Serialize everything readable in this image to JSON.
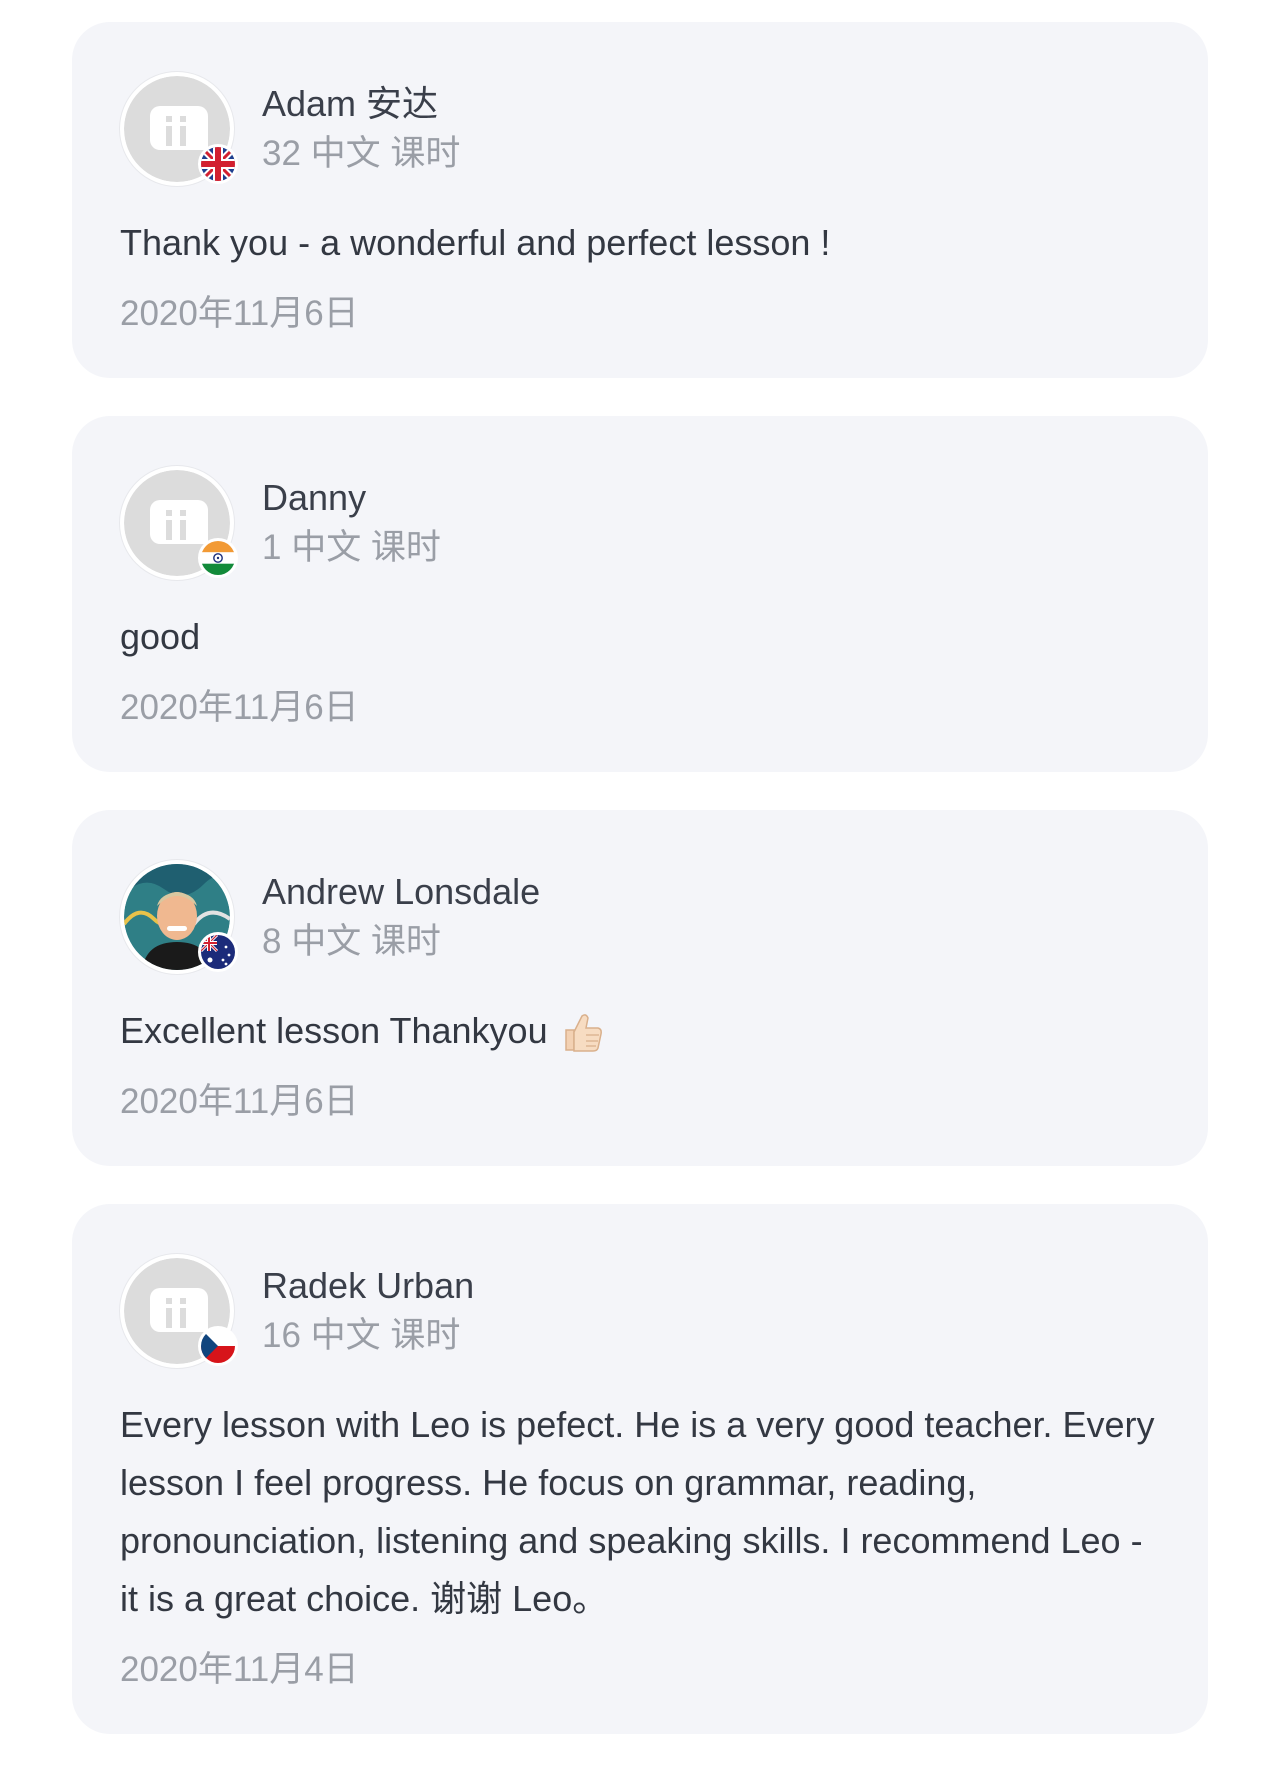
{
  "reviews": [
    {
      "name": "Adam 安达",
      "lessons": "32 中文 课时",
      "text": "Thank you - a wonderful and perfect lesson !",
      "date": "2020年11月6日",
      "flag": "uk-flag",
      "avatar": "default-avatar-icon"
    },
    {
      "name": "Danny",
      "lessons": "1 中文 课时",
      "text": "good",
      "date": "2020年11月6日",
      "flag": "india-flag",
      "avatar": "default-avatar-icon"
    },
    {
      "name": "Andrew Lonsdale",
      "lessons": "8 中文 课时",
      "text": "Excellent lesson Thankyou",
      "emoji": "thumbs-up-icon",
      "date": "2020年11月6日",
      "flag": "australia-flag",
      "avatar": "user-photo"
    },
    {
      "name": "Radek Urban",
      "lessons": "16 中文 课时",
      "text": "Every lesson with Leo is pefect. He is a very good teacher. Every lesson I feel progress. He focus on grammar, reading, pronounciation, listening and speaking skills. I recommend Leo - it is a great choice. 谢谢 Leo。",
      "date": "2020年11月4日",
      "flag": "czech-flag",
      "avatar": "default-avatar-icon"
    }
  ],
  "colors": {
    "card_bg": "#f4f5f9",
    "name": "#3a3f4a",
    "muted": "#9a9ea6",
    "body": "#333842"
  }
}
